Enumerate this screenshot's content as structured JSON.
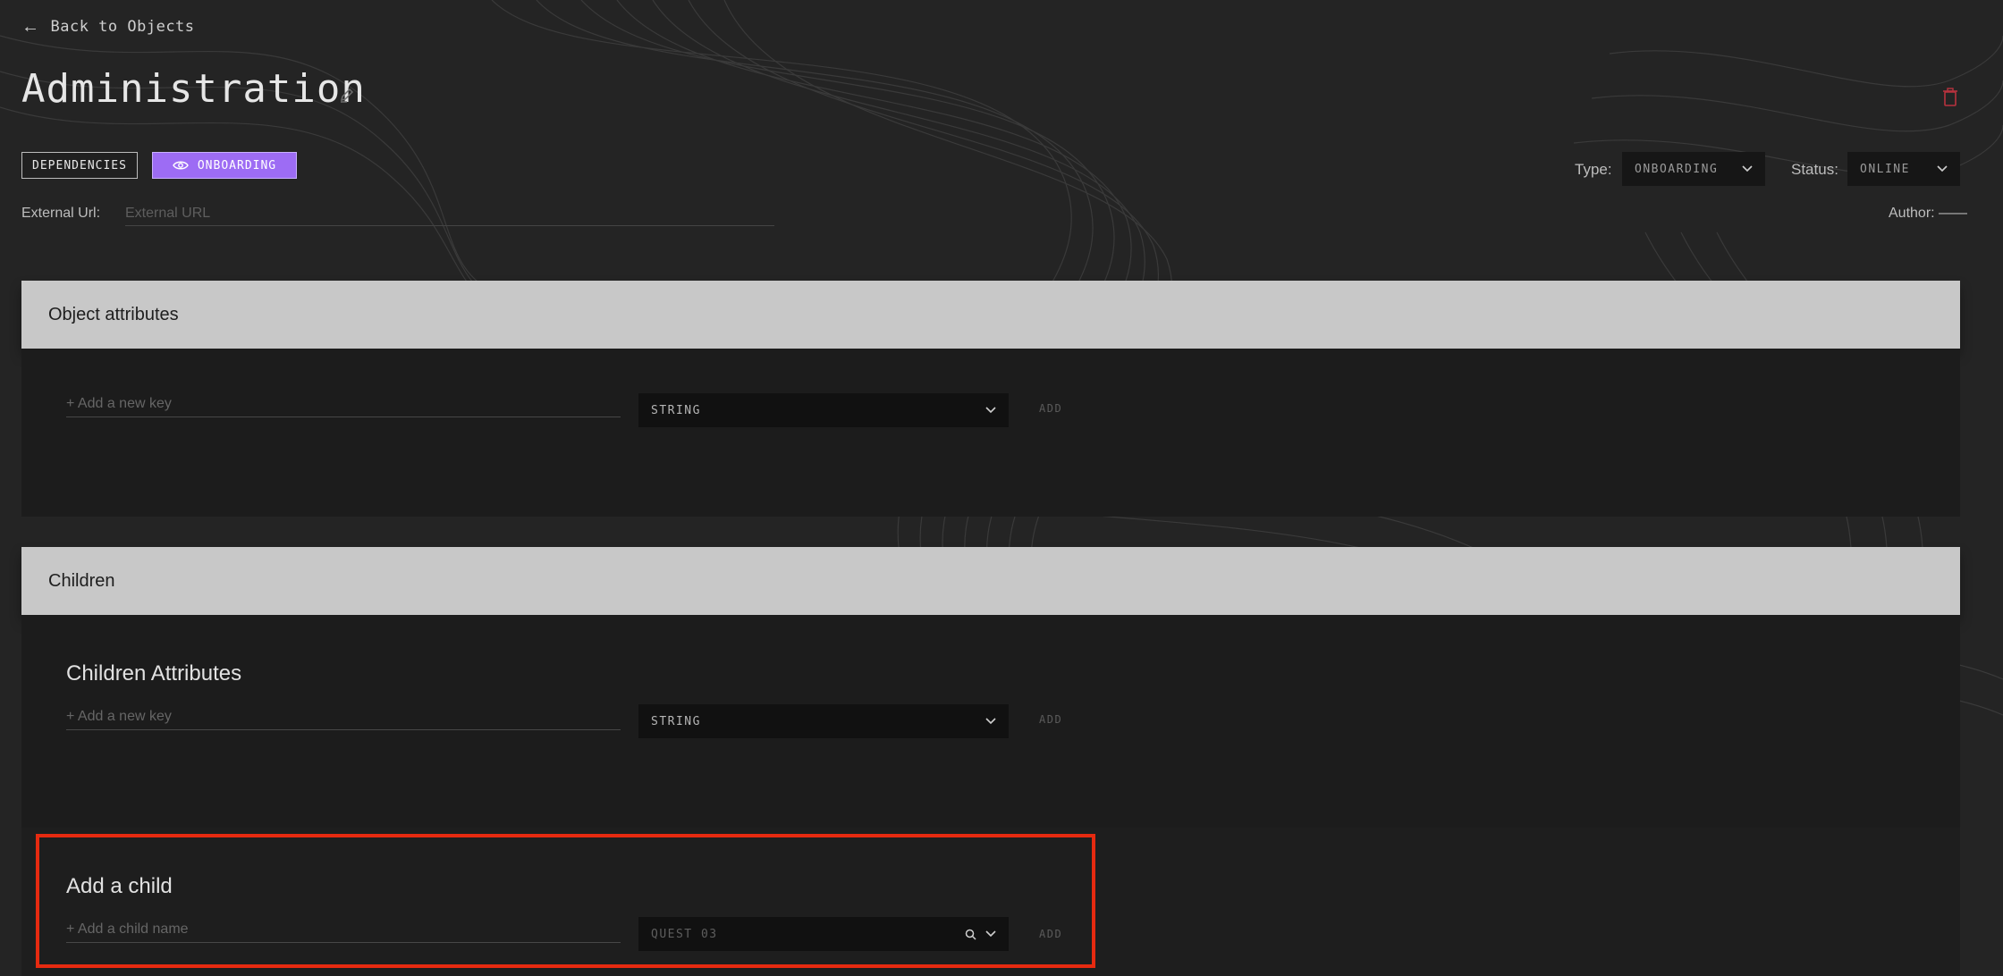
{
  "nav": {
    "back_label": "Back to Objects"
  },
  "object": {
    "title": "Administration",
    "tabs": [
      {
        "label": "DEPENDENCIES",
        "active": false
      },
      {
        "label": "ONBOARDING",
        "active": true
      }
    ],
    "type_label": "Type:",
    "type_value": "ONBOARDING",
    "status_label": "Status:",
    "status_value": "ONLINE",
    "external_url_label": "External Url:",
    "external_url_placeholder": "External URL",
    "author_label": "Author: ——"
  },
  "attributes_panel": {
    "header": "Object attributes",
    "key_placeholder": "+ Add a new key",
    "type_value": "STRING",
    "add_label": "ADD"
  },
  "children_panel": {
    "header": "Children",
    "attributes_title": "Children Attributes",
    "key_placeholder": "+ Add a new key",
    "type_value": "STRING",
    "add_label": "ADD",
    "add_child_title": "Add a child",
    "child_name_placeholder": "+ Add a child name",
    "child_template_value": "QUEST 03",
    "child_add_label": "ADD"
  },
  "colors": {
    "background": "#242424",
    "accent": "#9d6cf4",
    "panel_header": "#c8c8c8",
    "highlight": "#e62a10",
    "danger": "#b8323e"
  },
  "icons": [
    "arrow-left-icon",
    "pencil-icon",
    "trash-icon",
    "eye-icon",
    "chevron-down-icon",
    "search-icon"
  ]
}
